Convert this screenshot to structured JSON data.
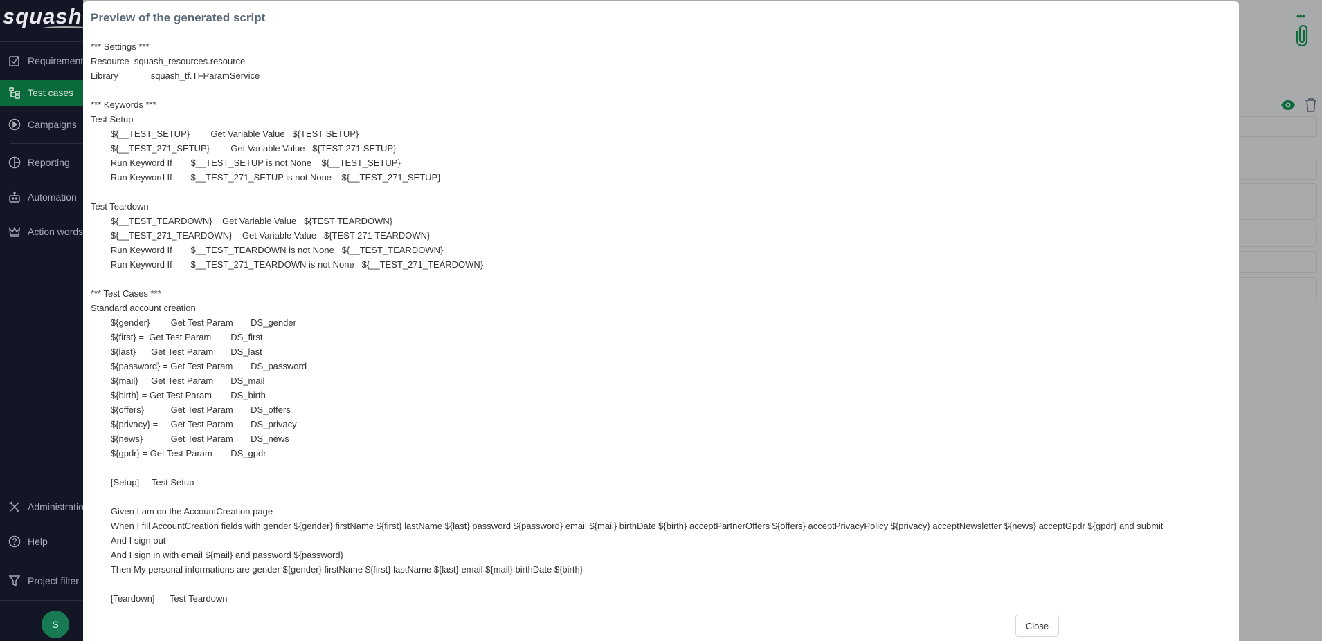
{
  "app": {
    "logo": "squash",
    "avatar_initial": "S"
  },
  "sidebar": {
    "items": [
      {
        "label": "Requirements",
        "icon": "checkbox-icon"
      },
      {
        "label": "Test cases",
        "icon": "tree-icon",
        "active": true
      },
      {
        "label": "Campaigns",
        "icon": "play-circle-icon"
      },
      {
        "label": "Reporting",
        "icon": "pie-chart-icon"
      },
      {
        "label": "Automation",
        "icon": "robot-icon"
      },
      {
        "label": "Action words",
        "icon": "crown-icon"
      },
      {
        "label": "Administration",
        "icon": "tools-icon"
      },
      {
        "label": "Help",
        "icon": "help-icon"
      },
      {
        "label": "Project filter",
        "icon": "filter-icon"
      }
    ]
  },
  "colors": {
    "accent": "#0b6a3a",
    "sidebar": "#131625",
    "title": "#5c6b7a"
  },
  "modal": {
    "title": "Preview of the generated script",
    "close_label": "Close",
    "script_lines": [
      "*** Settings ***",
      "Resource  squash_resources.resource",
      "Library\t\tsquash_tf.TFParamService",
      "",
      "*** Keywords ***",
      "Test Setup",
      "\t${__TEST_SETUP}\tGet Variable Value   ${TEST SETUP}",
      "\t${__TEST_271_SETUP}\tGet Variable Value   ${TEST 271 SETUP}",
      "\tRun Keyword If\t$__TEST_SETUP is not None    ${__TEST_SETUP}",
      "\tRun Keyword If\t$__TEST_271_SETUP is not None    ${__TEST_271_SETUP}",
      "",
      "Test Teardown",
      "\t${__TEST_TEARDOWN}    Get Variable Value   ${TEST TEARDOWN}",
      "\t${__TEST_271_TEARDOWN}    Get Variable Value   ${TEST 271 TEARDOWN}",
      "\tRun Keyword If\t$__TEST_TEARDOWN is not None   ${__TEST_TEARDOWN}",
      "\tRun Keyword If\t$__TEST_271_TEARDOWN is not None   ${__TEST_271_TEARDOWN}",
      "",
      "*** Test Cases ***",
      "Standard account creation",
      "\t${gender} =\tGet Test Param\tDS_gender",
      "\t${first} =  Get Test Param\tDS_first",
      "\t${last} =   Get Test Param\tDS_last",
      "\t${password} = Get Test Param\tDS_password",
      "\t${mail} =  Get Test Param\tDS_mail",
      "\t${birth} = Get Test Param\tDS_birth",
      "\t${offers} =\tGet Test Param\tDS_offers",
      "\t${privacy} =\tGet Test Param\tDS_privacy",
      "\t${news} =\tGet Test Param\tDS_news",
      "\t${gpdr} = Get Test Param\tDS_gpdr",
      "",
      "\t[Setup]     Test Setup",
      "",
      "\tGiven I am on the AccountCreation page",
      "\tWhen I fill AccountCreation fields with gender ${gender} firstName ${first} lastName ${last} password ${password} email ${mail} birthDate ${birth} acceptPartnerOffers ${offers} acceptPrivacyPolicy ${privacy} acceptNewsletter ${news} acceptGpdr ${gpdr} and submit",
      "\tAnd I sign out",
      "\tAnd I sign in with email ${mail} and password ${password}",
      "\tThen My personal informations are gender ${gender} firstName ${first} lastName ${last} email ${mail} birthDate ${birth}",
      "",
      "\t[Teardown]      Test Teardown"
    ]
  },
  "right_panel": {
    "icons": [
      "more-icon",
      "paperclip-icon",
      "eye-icon",
      "trash-icon"
    ]
  }
}
